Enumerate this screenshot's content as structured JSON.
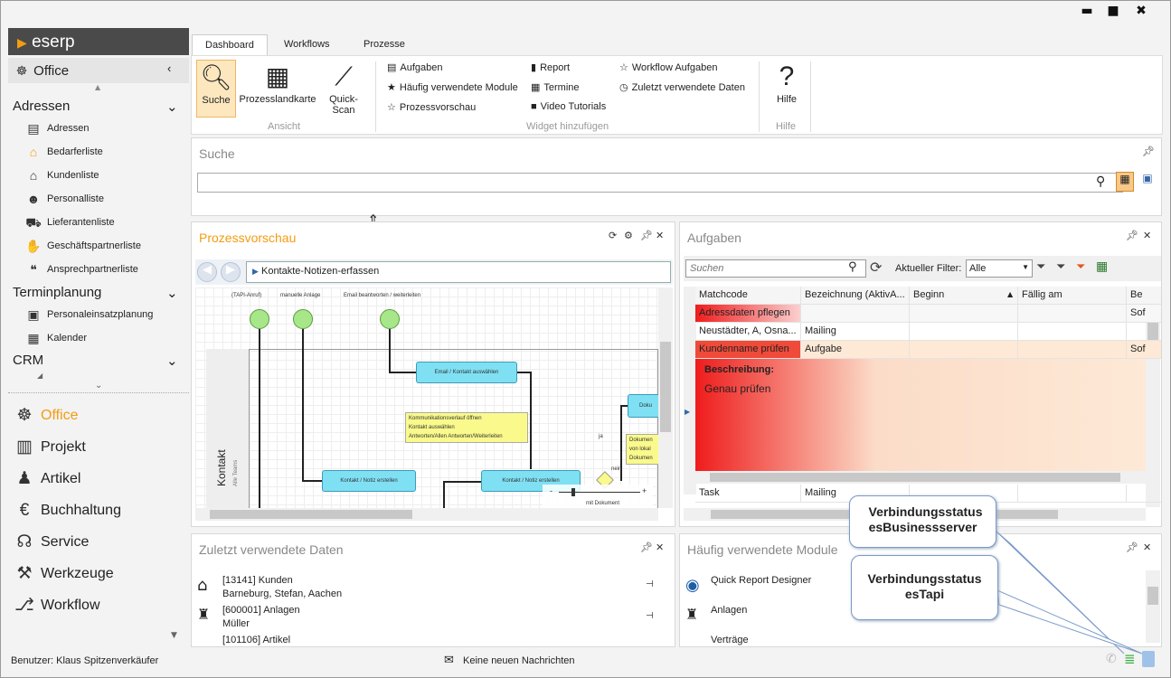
{
  "window": {
    "minimize": "▬",
    "maximize": "■",
    "close": "✖"
  },
  "logo": {
    "prefix": "",
    "text": "eserp"
  },
  "sidebar": {
    "top": {
      "label": "Office"
    },
    "groups": [
      {
        "label": "Adressen",
        "items": [
          "Adressen",
          "Bedarferliste",
          "Kundenliste",
          "Personalliste",
          "Lieferantenliste",
          "Geschäftspartnerliste",
          "Ansprechpartnerliste"
        ]
      },
      {
        "label": "Terminplanung",
        "items": [
          "Personaleinsatzplanung",
          "Kalender"
        ]
      },
      {
        "label": "CRM",
        "items": []
      }
    ],
    "modules": [
      "Office",
      "Projekt",
      "Artikel",
      "Buchhaltung",
      "Service",
      "Werkzeuge",
      "Workflow"
    ],
    "active_color": "#f39c12"
  },
  "tabs": [
    "Dashboard",
    "Workflows",
    "Prozesse"
  ],
  "ribbon": {
    "ansicht": {
      "label": "Ansicht",
      "buttons": [
        "Suche",
        "Prozesslandkarte",
        "Quick-Scan"
      ]
    },
    "widget": {
      "label": "Widget hinzufügen",
      "col1": [
        "Aufgaben",
        "Häufig verwendete Module",
        "Prozessvorschau"
      ],
      "col2": [
        "Report",
        "Termine",
        "Video Tutorials"
      ],
      "col3": [
        "Workflow Aufgaben",
        "Zuletzt verwendete Daten"
      ]
    },
    "hilfe": {
      "label": "Hilfe",
      "button": "Hilfe"
    }
  },
  "suche": {
    "title": "Suche",
    "value": ""
  },
  "prozess": {
    "title": "Prozessvorschau",
    "path": "Kontakte-Notizen-erfassen",
    "diagram": {
      "events": [
        "(TAPI-Anruf)",
        "manuelle Anlage",
        "Email beantworten / weiterleiten"
      ],
      "lane": "Kontakt",
      "lane_sub": "Alle Teams",
      "tasks": [
        "Email / Kontakt auswählen",
        "Kontakt / Notiz erstellen",
        "Kontakt / Notiz erstellen",
        "Doku"
      ],
      "note1": [
        "Kommunikationsverlauf öffnen",
        "Kontakt auswählen",
        "Antworten/Allen Antworten/Weiterleiten"
      ],
      "note2": [
        "Dokumen",
        "von lokal",
        "Dokumen"
      ],
      "ja": "ja",
      "nein": "nein",
      "zoom_caption": "mit Dokument"
    }
  },
  "aufgaben": {
    "title": "Aufgaben",
    "search_placeholder": "Suchen",
    "filter_label": "Aktueller Filter:",
    "filter_value": "Alle",
    "columns": [
      "Matchcode",
      "Bezeichnung (AktivA...",
      "Beginn",
      "Fällig am",
      "Be"
    ],
    "rows": [
      [
        "Adressdaten pflegen",
        "",
        "",
        "",
        "Sof"
      ],
      [
        "Neustädter, A, Osna...",
        "Mailing",
        "",
        "",
        ""
      ],
      [
        "Kundenname prüfen",
        "Aufgabe",
        "",
        "",
        "Sof"
      ]
    ],
    "detail_label": "Beschreibung:",
    "detail_text": "Genau prüfen",
    "rows_after": [
      [
        "Task",
        "Mailing"
      ]
    ]
  },
  "zuletzt": {
    "title": "Zuletzt verwendete Daten",
    "items": [
      {
        "line1": "[13141] Kunden",
        "line2": "Barneburg, Stefan, Aachen"
      },
      {
        "line1": "[600001] Anlagen",
        "line2": "Müller"
      },
      {
        "line1": "[101106] Artikel",
        "line2": ""
      }
    ]
  },
  "haeufig": {
    "title": "Häufig verwendete Module",
    "items": [
      "Quick Report Designer",
      "Anlagen",
      "Verträge"
    ]
  },
  "callouts": [
    "Verbindungsstatus esBusinessserver",
    "Verbindungsstatus esTapi"
  ],
  "status": {
    "user": "Benutzer: Klaus Spitzenverkäufer",
    "messages": "Keine neuen Nachrichten"
  }
}
